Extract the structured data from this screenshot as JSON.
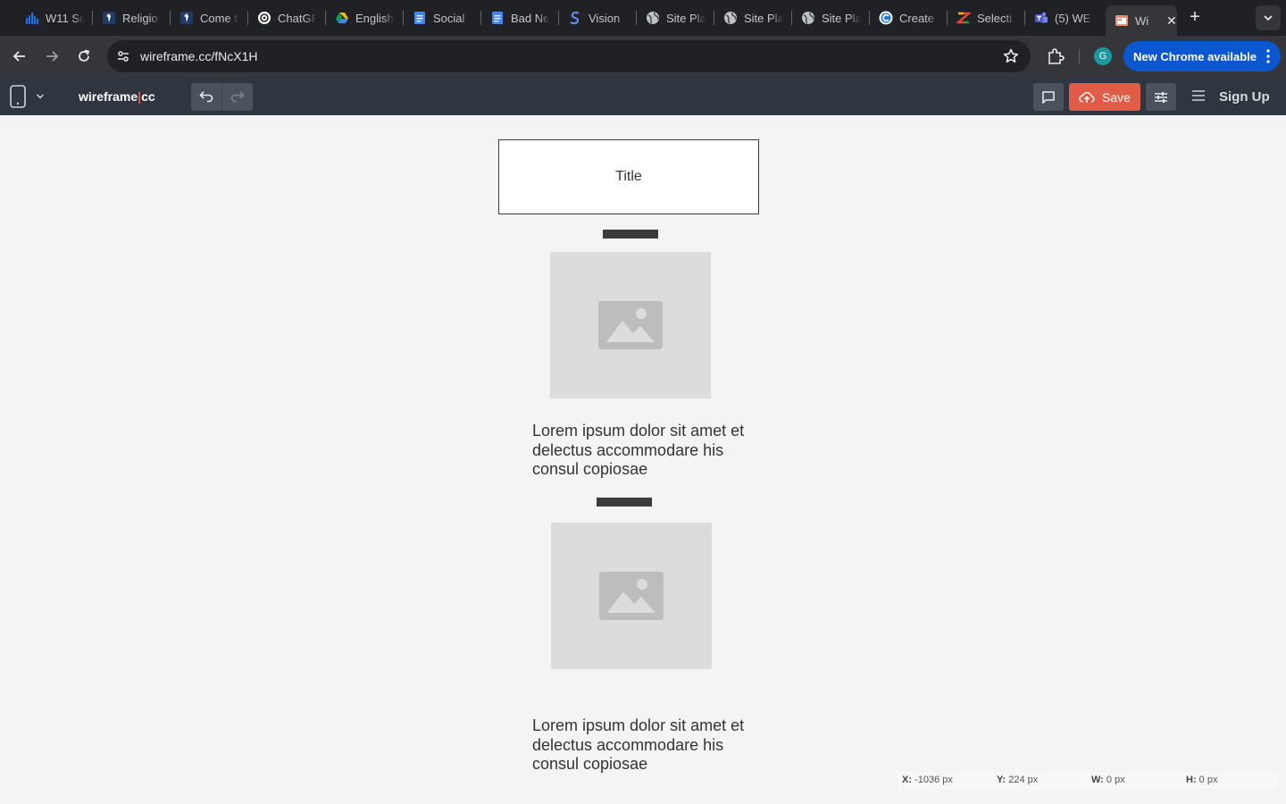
{
  "browser": {
    "tabs": [
      {
        "label": "W11 Sc",
        "icon": "chart-icon"
      },
      {
        "label": "Religio",
        "icon": "figure-icon"
      },
      {
        "label": "Come t",
        "icon": "figure-icon"
      },
      {
        "label": "ChatGF",
        "icon": "openai-icon"
      },
      {
        "label": "English",
        "icon": "drive-icon"
      },
      {
        "label": "Social",
        "icon": "docs-icon"
      },
      {
        "label": "Bad Ne",
        "icon": "docs-icon"
      },
      {
        "label": "Vision",
        "icon": "s-icon"
      },
      {
        "label": "Site Pla",
        "icon": "globe-icon"
      },
      {
        "label": "Site Pla",
        "icon": "globe-icon"
      },
      {
        "label": "Site Pla",
        "icon": "globe-icon"
      },
      {
        "label": "Create",
        "icon": "c-icon"
      },
      {
        "label": "Selecti",
        "icon": "z-icon"
      },
      {
        "label": "(5) WE",
        "icon": "teams-icon"
      },
      {
        "label": "Wi",
        "icon": "wireframe-icon",
        "active": true
      }
    ],
    "url": "wireframe.cc/fNcX1H",
    "profile_initial": "G",
    "update_label": "New Chrome available"
  },
  "app": {
    "brand_left": "wireframe",
    "brand_pipe": "|",
    "brand_right": "cc",
    "save_label": "Save",
    "signup_label": "Sign Up"
  },
  "canvas": {
    "title_box": "Title",
    "paragraph_1": "Lorem ipsum dolor sit amet et delectus accommodare his consul copiosae",
    "paragraph_2": "Lorem ipsum dolor sit amet et delectus accommodare his consul copiosae"
  },
  "status": {
    "x_label": "X:",
    "x_value": "-1036 px",
    "y_label": "Y:",
    "y_value": "224 px",
    "w_label": "W:",
    "w_value": "0 px",
    "h_label": "H:",
    "h_value": "0 px"
  },
  "colors": {
    "accent": "#e05c47",
    "appbar": "#2f3640",
    "chrome_update": "#0b57d0"
  }
}
